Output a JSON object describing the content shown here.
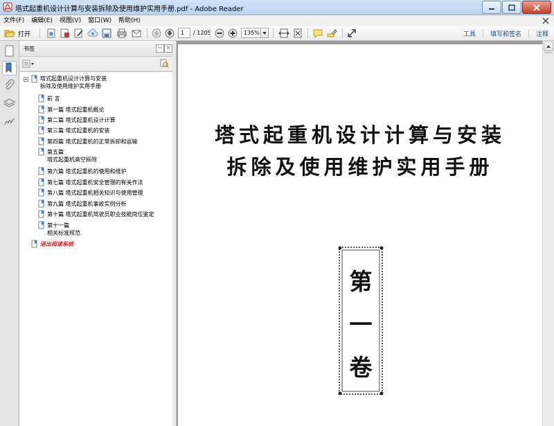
{
  "window": {
    "title": "塔式起重机设计计算与安装拆除及使用维护实用手册.pdf - Adobe Reader"
  },
  "menu": [
    "文件(F)",
    "编辑(E)",
    "视图(V)",
    "窗口(W)",
    "帮助(H)"
  ],
  "toolbar": {
    "open_label": "打开",
    "page_current": "1",
    "page_total": "/ 1205",
    "zoom": "135%",
    "tools_label": "工具",
    "fill_sign_label": "填写和签名",
    "comment_label": "注释"
  },
  "panel": {
    "title": "书签",
    "bookmarks": [
      {
        "label": "塔式起重机设计计算与安装",
        "label2": "拆除及使用维护实用手册"
      },
      {
        "label": "前  言"
      },
      {
        "label": "第一篇  塔式起重机概论"
      },
      {
        "label": "第二篇  塔式起重机设计计算"
      },
      {
        "label": "第三篇  塔式起重机的安装"
      },
      {
        "label": "第四篇  塔式起重机的正常拆卸和运输"
      },
      {
        "label": "第五篇",
        "label2": "塔式起重机高空拆除"
      },
      {
        "label": "第六篇  塔式起重机的使用和维护"
      },
      {
        "label": "第七篇  塔式起重机安全管理的有关作法"
      },
      {
        "label": "第八篇  塔式起重机相关知识与使用管理"
      },
      {
        "label": "第九篇  塔式起重机事故实例分析"
      },
      {
        "label": "第十篇  塔式起重机驾驶员职业技能岗位鉴定"
      },
      {
        "label": "第十一篇",
        "label2": "相关标准规范"
      },
      {
        "label": "退出阅读系统"
      }
    ]
  },
  "document": {
    "title_line1": "塔式起重机设计计算与安装",
    "title_line2": "拆除及使用维护实用手册",
    "volume": [
      "第",
      "一",
      "卷"
    ]
  },
  "colors": {
    "exit_link": "#e02020",
    "link": "#1c4e8a"
  }
}
